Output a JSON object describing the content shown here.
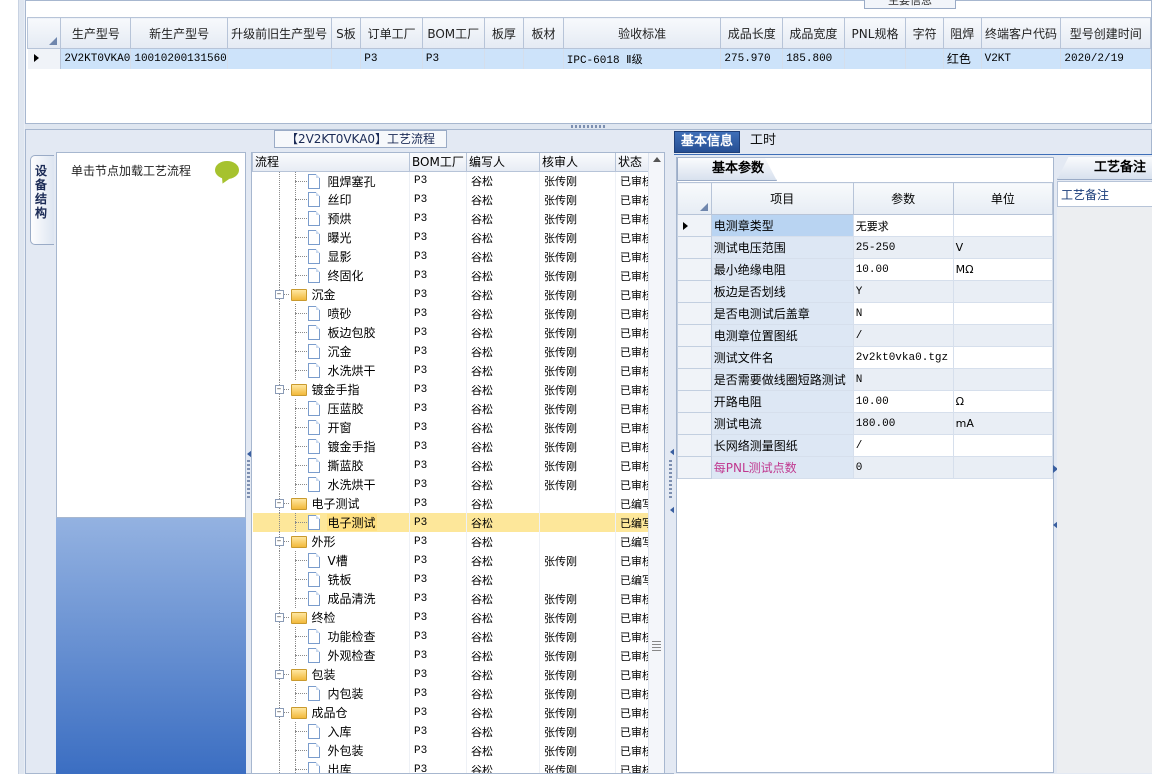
{
  "top_panel": {
    "caption": "主要信息",
    "columns": [
      "生产型号",
      "新生产型号",
      "升级前旧生产型号",
      "S板",
      "订单工厂",
      "BOM工厂",
      "板厚",
      "板材",
      "验收标准",
      "成品长度",
      "成品宽度",
      "PNL规格",
      "字符",
      "阻焊",
      "终端客户代码",
      "型号创建时间"
    ],
    "row": [
      "2V2KT0VKA0",
      "10010200131560",
      "",
      "",
      "P3",
      "P3",
      "",
      "",
      "IPC-6018 Ⅱ级",
      "275.970",
      "185.800",
      "",
      "",
      "红色",
      "V2KT",
      "2020/2/19"
    ]
  },
  "flow": {
    "caption": "【2V2KT0VKA0】工艺流程"
  },
  "side_tab": {
    "label": "设备结构"
  },
  "left_panel": {
    "hint": "单击节点加载工艺流程"
  },
  "tree": {
    "columns": [
      "流程",
      "BOM工厂",
      "编写人",
      "核审人",
      "状态"
    ],
    "rows": [
      {
        "level": 2,
        "type": "item",
        "name": "阻焊塞孔",
        "bom": "P3",
        "writer": "谷松",
        "reviewer": "张传刚",
        "status": "已审核"
      },
      {
        "level": 2,
        "type": "item",
        "name": "丝印",
        "bom": "P3",
        "writer": "谷松",
        "reviewer": "张传刚",
        "status": "已审核"
      },
      {
        "level": 2,
        "type": "item",
        "name": "预烘",
        "bom": "P3",
        "writer": "谷松",
        "reviewer": "张传刚",
        "status": "已审核"
      },
      {
        "level": 2,
        "type": "item",
        "name": "曝光",
        "bom": "P3",
        "writer": "谷松",
        "reviewer": "张传刚",
        "status": "已审核"
      },
      {
        "level": 2,
        "type": "item",
        "name": "显影",
        "bom": "P3",
        "writer": "谷松",
        "reviewer": "张传刚",
        "status": "已审核"
      },
      {
        "level": 2,
        "type": "item",
        "name": "终固化",
        "bom": "P3",
        "writer": "谷松",
        "reviewer": "张传刚",
        "status": "已审核"
      },
      {
        "level": 1,
        "type": "folder",
        "name": "沉金",
        "bom": "P3",
        "writer": "谷松",
        "reviewer": "张传刚",
        "status": "已审核"
      },
      {
        "level": 2,
        "type": "item",
        "name": "喷砂",
        "bom": "P3",
        "writer": "谷松",
        "reviewer": "张传刚",
        "status": "已审核"
      },
      {
        "level": 2,
        "type": "item",
        "name": "板边包胶",
        "bom": "P3",
        "writer": "谷松",
        "reviewer": "张传刚",
        "status": "已审核"
      },
      {
        "level": 2,
        "type": "item",
        "name": "沉金",
        "bom": "P3",
        "writer": "谷松",
        "reviewer": "张传刚",
        "status": "已审核"
      },
      {
        "level": 2,
        "type": "item",
        "name": "水洗烘干",
        "bom": "P3",
        "writer": "谷松",
        "reviewer": "张传刚",
        "status": "已审核"
      },
      {
        "level": 1,
        "type": "folder",
        "name": "镀金手指",
        "bom": "P3",
        "writer": "谷松",
        "reviewer": "张传刚",
        "status": "已审核"
      },
      {
        "level": 2,
        "type": "item",
        "name": "压蓝胶",
        "bom": "P3",
        "writer": "谷松",
        "reviewer": "张传刚",
        "status": "已审核"
      },
      {
        "level": 2,
        "type": "item",
        "name": "开窗",
        "bom": "P3",
        "writer": "谷松",
        "reviewer": "张传刚",
        "status": "已审核"
      },
      {
        "level": 2,
        "type": "item",
        "name": "镀金手指",
        "bom": "P3",
        "writer": "谷松",
        "reviewer": "张传刚",
        "status": "已审核"
      },
      {
        "level": 2,
        "type": "item",
        "name": "撕蓝胶",
        "bom": "P3",
        "writer": "谷松",
        "reviewer": "张传刚",
        "status": "已审核"
      },
      {
        "level": 2,
        "type": "item",
        "name": "水洗烘干",
        "bom": "P3",
        "writer": "谷松",
        "reviewer": "张传刚",
        "status": "已审核"
      },
      {
        "level": 1,
        "type": "folder",
        "name": "电子测试",
        "bom": "P3",
        "writer": "谷松",
        "reviewer": "",
        "status": "已编写"
      },
      {
        "level": 2,
        "type": "item",
        "name": "电子测试",
        "bom": "P3",
        "writer": "谷松",
        "reviewer": "",
        "status": "已编写",
        "selected": true
      },
      {
        "level": 1,
        "type": "folder",
        "name": "外形",
        "bom": "P3",
        "writer": "谷松",
        "reviewer": "",
        "status": "已编写"
      },
      {
        "level": 2,
        "type": "item",
        "name": "V槽",
        "bom": "P3",
        "writer": "谷松",
        "reviewer": "张传刚",
        "status": "已审核"
      },
      {
        "level": 2,
        "type": "item",
        "name": "铣板",
        "bom": "P3",
        "writer": "谷松",
        "reviewer": "",
        "status": "已编写"
      },
      {
        "level": 2,
        "type": "item",
        "name": "成品清洗",
        "bom": "P3",
        "writer": "谷松",
        "reviewer": "张传刚",
        "status": "已审核"
      },
      {
        "level": 1,
        "type": "folder",
        "name": "终检",
        "bom": "P3",
        "writer": "谷松",
        "reviewer": "张传刚",
        "status": "已审核"
      },
      {
        "level": 2,
        "type": "item",
        "name": "功能检查",
        "bom": "P3",
        "writer": "谷松",
        "reviewer": "张传刚",
        "status": "已审核"
      },
      {
        "level": 2,
        "type": "item",
        "name": "外观检查",
        "bom": "P3",
        "writer": "谷松",
        "reviewer": "张传刚",
        "status": "已审核"
      },
      {
        "level": 1,
        "type": "folder",
        "name": "包装",
        "bom": "P3",
        "writer": "谷松",
        "reviewer": "张传刚",
        "status": "已审核"
      },
      {
        "level": 2,
        "type": "item",
        "name": "内包装",
        "bom": "P3",
        "writer": "谷松",
        "reviewer": "张传刚",
        "status": "已审核"
      },
      {
        "level": 1,
        "type": "folder",
        "name": "成品仓",
        "bom": "P3",
        "writer": "谷松",
        "reviewer": "张传刚",
        "status": "已审核"
      },
      {
        "level": 2,
        "type": "item",
        "name": "入库",
        "bom": "P3",
        "writer": "谷松",
        "reviewer": "张传刚",
        "status": "已审核"
      },
      {
        "level": 2,
        "type": "item",
        "name": "外包装",
        "bom": "P3",
        "writer": "谷松",
        "reviewer": "张传刚",
        "status": "已审核"
      },
      {
        "level": 2,
        "type": "item",
        "name": "出库",
        "bom": "P3",
        "writer": "谷松",
        "reviewer": "张传刚",
        "status": "已审核"
      }
    ]
  },
  "right_tabs": [
    "基本信息",
    "工时"
  ],
  "params": {
    "tab": "基本参数",
    "columns": [
      "项目",
      "参数",
      "单位"
    ],
    "rows": [
      {
        "item": "电测章类型",
        "value": "无要求",
        "unit": "",
        "current": true
      },
      {
        "item": "测试电压范围",
        "value": "25-250",
        "unit": "V"
      },
      {
        "item": "最小绝缘电阻",
        "value": "10.00",
        "unit": "MΩ"
      },
      {
        "item": "板边是否划线",
        "value": "Y",
        "unit": ""
      },
      {
        "item": "是否电测试后盖章",
        "value": "N",
        "unit": ""
      },
      {
        "item": "电测章位置图纸",
        "value": "/",
        "unit": ""
      },
      {
        "item": "测试文件名",
        "value": "2v2kt0vka0.tgz",
        "unit": ""
      },
      {
        "item": "是否需要做线圈短路测试",
        "value": "N",
        "unit": ""
      },
      {
        "item": "开路电阻",
        "value": "10.00",
        "unit": "Ω"
      },
      {
        "item": "测试电流",
        "value": "180.00",
        "unit": "mA"
      },
      {
        "item": "长网络测量图纸",
        "value": "/",
        "unit": ""
      },
      {
        "item": "每PNL测试点数",
        "value": "0",
        "unit": "",
        "pink": true
      }
    ]
  },
  "notes": {
    "tab": "工艺备注",
    "header": "工艺备注"
  },
  "colors": {
    "selected_row": "#fde79a",
    "tab_active": "#264f93",
    "grid_row_selected": "#cde3fa",
    "pink_text": "#c0388f"
  }
}
